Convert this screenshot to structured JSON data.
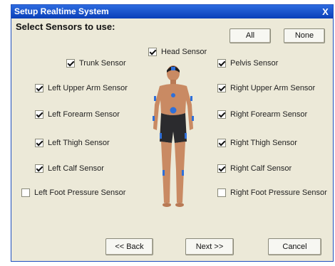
{
  "window": {
    "title": "Setup Realtime System",
    "close_glyph": "X"
  },
  "heading": "Select Sensors to use:",
  "buttons": {
    "all": "All",
    "none": "None",
    "back": "<< Back",
    "next": "Next >>",
    "cancel": "Cancel"
  },
  "sensors": {
    "head": {
      "label": "Head Sensor",
      "checked": true
    },
    "trunk": {
      "label": "Trunk Sensor",
      "checked": true
    },
    "pelvis": {
      "label": "Pelvis Sensor",
      "checked": true
    },
    "left_upper_arm": {
      "label": "Left Upper Arm Sensor",
      "checked": true
    },
    "right_upper_arm": {
      "label": "Right Upper Arm Sensor",
      "checked": true
    },
    "left_forearm": {
      "label": "Left Forearm Sensor",
      "checked": true
    },
    "right_forearm": {
      "label": "Right Forearm Sensor",
      "checked": true
    },
    "left_thigh": {
      "label": "Left Thigh Sensor",
      "checked": true
    },
    "right_thigh": {
      "label": "Right Thigh Sensor",
      "checked": true
    },
    "left_calf": {
      "label": "Left Calf Sensor",
      "checked": true
    },
    "right_calf": {
      "label": "Right Calf Sensor",
      "checked": true
    },
    "left_foot_pressure": {
      "label": "Left Foot Pressure Sensor",
      "checked": false
    },
    "right_foot_pressure": {
      "label": "Right Foot Pressure Sensor",
      "checked": false
    }
  },
  "colors": {
    "title_bar": "#0a3fb8",
    "window_bg": "#ece9d8",
    "skin": "#c98a63",
    "shorts": "#2b2b2e",
    "sensor_marker": "#2f6fd8"
  }
}
